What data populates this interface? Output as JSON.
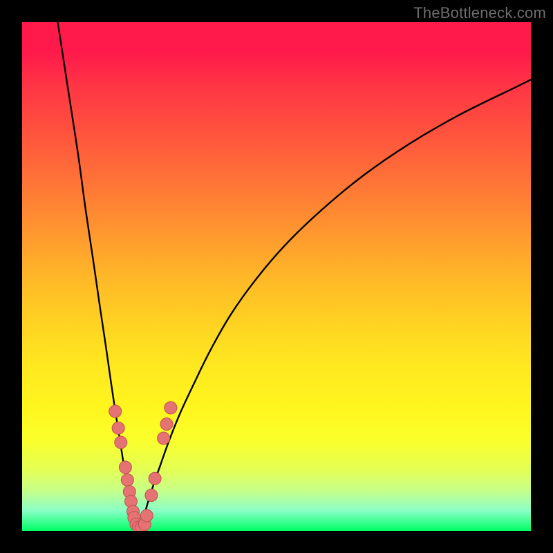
{
  "watermark": "TheBottleneck.com",
  "colors": {
    "frame": "#000000",
    "curve": "#000000",
    "dot_fill": "#e57373",
    "dot_stroke": "#c05050",
    "gradient_top": "#ff1a4b",
    "gradient_bottom": "#00ff66"
  },
  "chart_data": {
    "type": "line",
    "title": "",
    "xlabel": "",
    "ylabel": "",
    "xlim": [
      0,
      100
    ],
    "ylim": [
      0,
      100
    ],
    "note": "No axis ticks or numeric labels are rendered; x/y are percent of plot area. y=0 is top, y=100 is bottom (green).",
    "series": [
      {
        "name": "left-branch",
        "x": [
          7,
          9,
          11,
          12.5,
          14,
          15.3,
          16.5,
          17.5,
          18.4,
          19.2,
          19.9,
          20.5,
          21.0,
          21.5,
          21.9,
          22.3,
          23.0
        ],
        "y": [
          0,
          13,
          26,
          37,
          47,
          56,
          64,
          71,
          77,
          82,
          86.5,
          90,
          93,
          95.3,
          97,
          98.3,
          100
        ]
      },
      {
        "name": "right-branch",
        "x": [
          23.0,
          23.8,
          24.7,
          25.8,
          27.2,
          28.8,
          31.0,
          33.8,
          37.0,
          41.0,
          46.0,
          52.0,
          59.0,
          67.0,
          76.0,
          86.0,
          97.0,
          100.0
        ],
        "y": [
          100,
          97.5,
          94.5,
          91,
          87,
          82.5,
          77,
          71,
          64.5,
          57.5,
          50.5,
          43.5,
          36.8,
          30.2,
          24.0,
          18.2,
          12.8,
          11.3
        ]
      }
    ],
    "scatter": {
      "name": "highlight-dots",
      "points": [
        {
          "x": 18.3,
          "y": 76.5
        },
        {
          "x": 18.9,
          "y": 79.8
        },
        {
          "x": 19.4,
          "y": 82.6
        },
        {
          "x": 20.3,
          "y": 87.5
        },
        {
          "x": 20.7,
          "y": 90.0
        },
        {
          "x": 21.1,
          "y": 92.3
        },
        {
          "x": 21.4,
          "y": 94.2
        },
        {
          "x": 21.8,
          "y": 96.2
        },
        {
          "x": 22.0,
          "y": 97.4
        },
        {
          "x": 22.4,
          "y": 98.7
        },
        {
          "x": 22.9,
          "y": 99.3
        },
        {
          "x": 23.5,
          "y": 99.3
        },
        {
          "x": 24.1,
          "y": 98.7
        },
        {
          "x": 24.5,
          "y": 97.0
        },
        {
          "x": 25.4,
          "y": 93.0
        },
        {
          "x": 26.1,
          "y": 89.7
        },
        {
          "x": 27.8,
          "y": 81.8
        },
        {
          "x": 28.4,
          "y": 79.0
        },
        {
          "x": 29.2,
          "y": 75.8
        }
      ]
    }
  }
}
